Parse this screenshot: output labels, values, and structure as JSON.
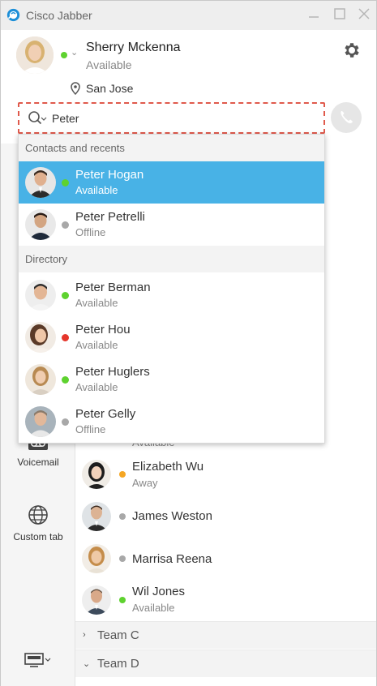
{
  "app": {
    "title": "Cisco Jabber"
  },
  "colors": {
    "available": "#5ed22f",
    "away": "#f5a623",
    "busy": "#e5362b",
    "offline": "#a8a8a8",
    "selected": "#48b2e6",
    "search_border": "#e05a4c"
  },
  "profile": {
    "name": "Sherry Mckenna",
    "status": "Available",
    "presence": "available",
    "location": "San Jose"
  },
  "search": {
    "value": "Peter"
  },
  "dropdown": {
    "sections": [
      {
        "title": "Contacts and recents",
        "items": [
          {
            "name": "Peter Hogan",
            "status": "Available",
            "presence": "available",
            "selected": true
          },
          {
            "name": "Peter Petrelli",
            "status": "Offline",
            "presence": "offline",
            "selected": false
          }
        ]
      },
      {
        "title": "Directory",
        "items": [
          {
            "name": "Peter Berman",
            "status": "Available",
            "presence": "available"
          },
          {
            "name": "Peter Hou",
            "status": "Available",
            "presence": "busy"
          },
          {
            "name": "Peter Huglers",
            "status": "Available",
            "presence": "available"
          },
          {
            "name": "Peter Gelly",
            "status": "Offline",
            "presence": "offline"
          }
        ]
      }
    ]
  },
  "sidenav": {
    "items": [
      {
        "label": "Voicemail",
        "icon": "voicemail-icon"
      },
      {
        "label": "Custom tab",
        "icon": "globe-icon"
      }
    ],
    "bottom_icon": "display-icon"
  },
  "contacts": {
    "partial_status": "Available",
    "items": [
      {
        "name": "Elizabeth Wu",
        "status": "Away",
        "presence": "away"
      },
      {
        "name": "James Weston",
        "status": "",
        "presence": "offline"
      },
      {
        "name": "Marrisa Reena",
        "status": "",
        "presence": "offline"
      },
      {
        "name": "Wil Jones",
        "status": "Available",
        "presence": "available"
      }
    ],
    "groups": [
      {
        "label": "Team C",
        "expanded": false
      },
      {
        "label": "Team D",
        "expanded": true
      }
    ]
  }
}
